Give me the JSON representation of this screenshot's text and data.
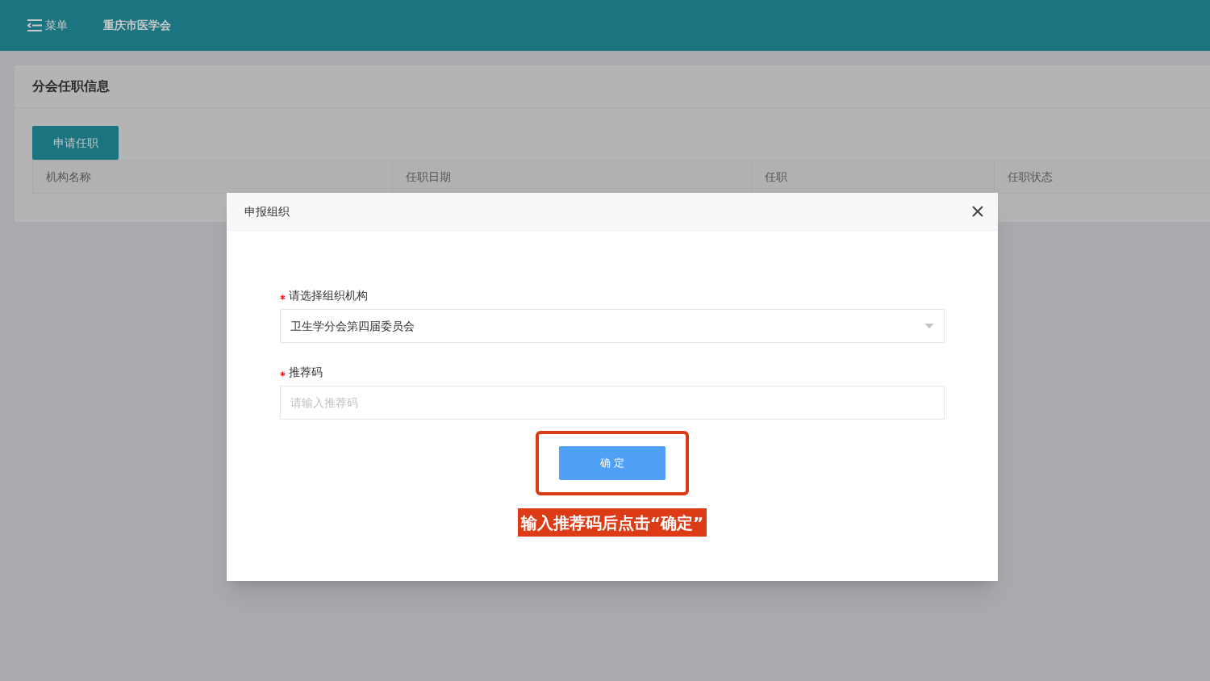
{
  "header": {
    "menu_label": "菜单",
    "site_title": "重庆市医学会"
  },
  "section": {
    "title": "分会任职信息",
    "apply_button": "申请任职"
  },
  "table": {
    "columns": [
      "机构名称",
      "任职日期",
      "任职",
      "任职状态"
    ]
  },
  "dialog": {
    "title": "申报组织",
    "fields": [
      {
        "kind": "select",
        "required": true,
        "label": "请选择组织机构",
        "value": "卫生学分会第四届委员会"
      },
      {
        "kind": "input",
        "required": true,
        "label": "推荐码",
        "placeholder": "请输入推荐码"
      }
    ],
    "confirm_button": "确 定",
    "annotation": "输入推荐码后点击“确定”"
  }
}
